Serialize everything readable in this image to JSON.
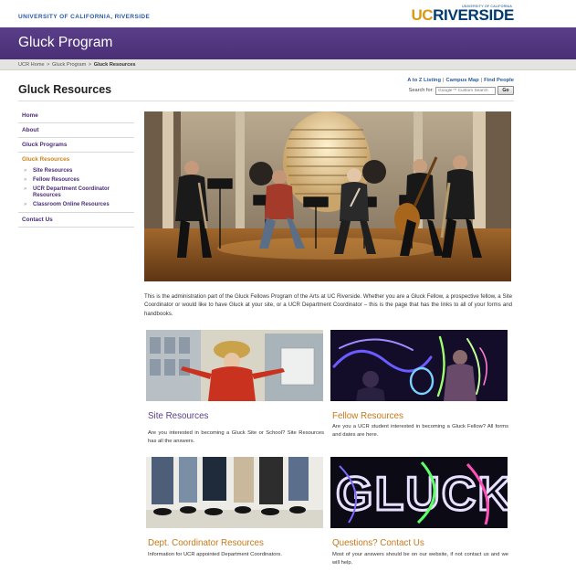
{
  "header": {
    "university_link": "UNIVERSITY OF CALIFORNIA, RIVERSIDE",
    "logo_small": "UNIVERSITY OF CALIFORNIA",
    "logo_uc": "UC",
    "logo_riverside": "RIVERSIDE"
  },
  "banner": {
    "title": "Gluck Program"
  },
  "breadcrumb": {
    "home": "UCR Home",
    "section": "Gluck Program",
    "current": "Gluck Resources",
    "separator": ">"
  },
  "page": {
    "title": "Gluck Resources"
  },
  "utility": {
    "links": [
      "A to Z Listing",
      "Campus Map",
      "Find People"
    ],
    "search_label": "Search for:",
    "search_placeholder": "Google™ Custom Search",
    "search_button": "Go"
  },
  "sidebar": {
    "items": [
      {
        "label": "Home"
      },
      {
        "label": "About"
      },
      {
        "label": "Gluck Programs"
      },
      {
        "label": "Gluck Resources"
      },
      {
        "label": "Contact Us"
      }
    ],
    "subitems": [
      {
        "label": "Site Resources"
      },
      {
        "label": "Fellow Resources"
      },
      {
        "label": "UCR Department Coordinator Resources"
      },
      {
        "label": "Classroom Online Resources"
      }
    ],
    "arrow": "»"
  },
  "intro": {
    "text": "This is the administration part of the Gluck Fellows Program of the Arts at UC Riverside.  Whether you are a Gluck Fellow, a prospective fellow, a Site Coordinator or would like to have Gluck at your site, or a UCR Department Coordinator – this is the page that has the links to all of your forms and handbooks."
  },
  "tiles": [
    {
      "title": "Site Resources",
      "desc": "Are you interested in becoming a Gluck Site or School? Site Resources has all the answers."
    },
    {
      "title": "Fellow Resources",
      "desc": "Are you a UCR student interested in becoming a Gluck Fellow? All forms and dates are here."
    },
    {
      "title": "Dept. Coordinator Resources",
      "desc": "Information for UCR appointed Department Coordinators."
    },
    {
      "title": "Questions? Contact Us",
      "desc": "Most of your answers should be on our website, if not contact us and we will help."
    }
  ],
  "light_text": "GLUCK",
  "colors": {
    "purple": "#4a2f77",
    "gold": "#c8781a",
    "link_blue": "#2c5aa0"
  }
}
